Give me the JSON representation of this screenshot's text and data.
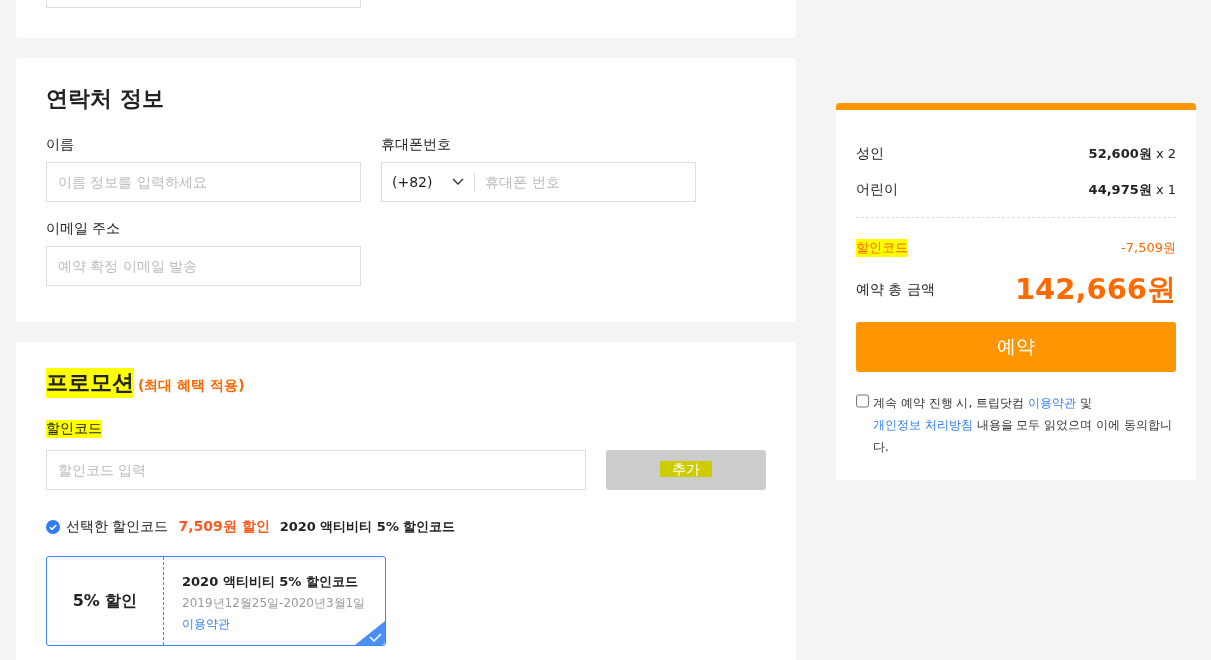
{
  "contact": {
    "title": "연락처 정보",
    "fields": [
      {
        "label": "이름",
        "placeholder": "이름 정보를 입력하세요"
      },
      {
        "label": "휴대폰번호",
        "kind": "phone",
        "code": "(+82)",
        "placeholder": "휴대폰 번호"
      },
      {
        "label": "이메일 주소",
        "placeholder": "예약 확정 이메일 발송"
      }
    ]
  },
  "promotion": {
    "title": "프로모션",
    "title_highlighted": true,
    "note": "(최대 혜택 적용)",
    "code_label": "할인코드",
    "code_label_highlighted": true,
    "code_placeholder": "할인코드 입력",
    "add_button": "추가",
    "add_button_highlighted": true,
    "add_disabled": true,
    "selected_summary": {
      "label": "선택한 할인코드",
      "amount": "7,509원 할인",
      "name": "2020 액티비티 5% 할인코드"
    },
    "coupons": [
      {
        "value": "5% 할인",
        "name": "2020 액티비티 5% 할인코드",
        "period": "2019년12월25일-2020년3월1일",
        "terms": "이용약관",
        "selected": true
      }
    ]
  },
  "summary": {
    "items": [
      {
        "label": "성인",
        "price": "52,600원",
        "qty": "x 2"
      },
      {
        "label": "어린이",
        "price": "44,975원",
        "qty": "x 1"
      }
    ],
    "discount": {
      "label": "할인코드",
      "highlighted": true,
      "amount": "-7,509원"
    },
    "total": {
      "label": "예약 총 금액",
      "amount": "142,666원"
    },
    "book_button": "예약",
    "agreement": {
      "checked": false,
      "text_1": "계속 예약 진행 시, 트립닷컴 ",
      "link_1": "이용약관",
      "text_2": " 및 ",
      "link_2": "개인정보 처리방침",
      "text_3": " 내용을 모두 읽었으며 이에 동의합니다."
    }
  }
}
